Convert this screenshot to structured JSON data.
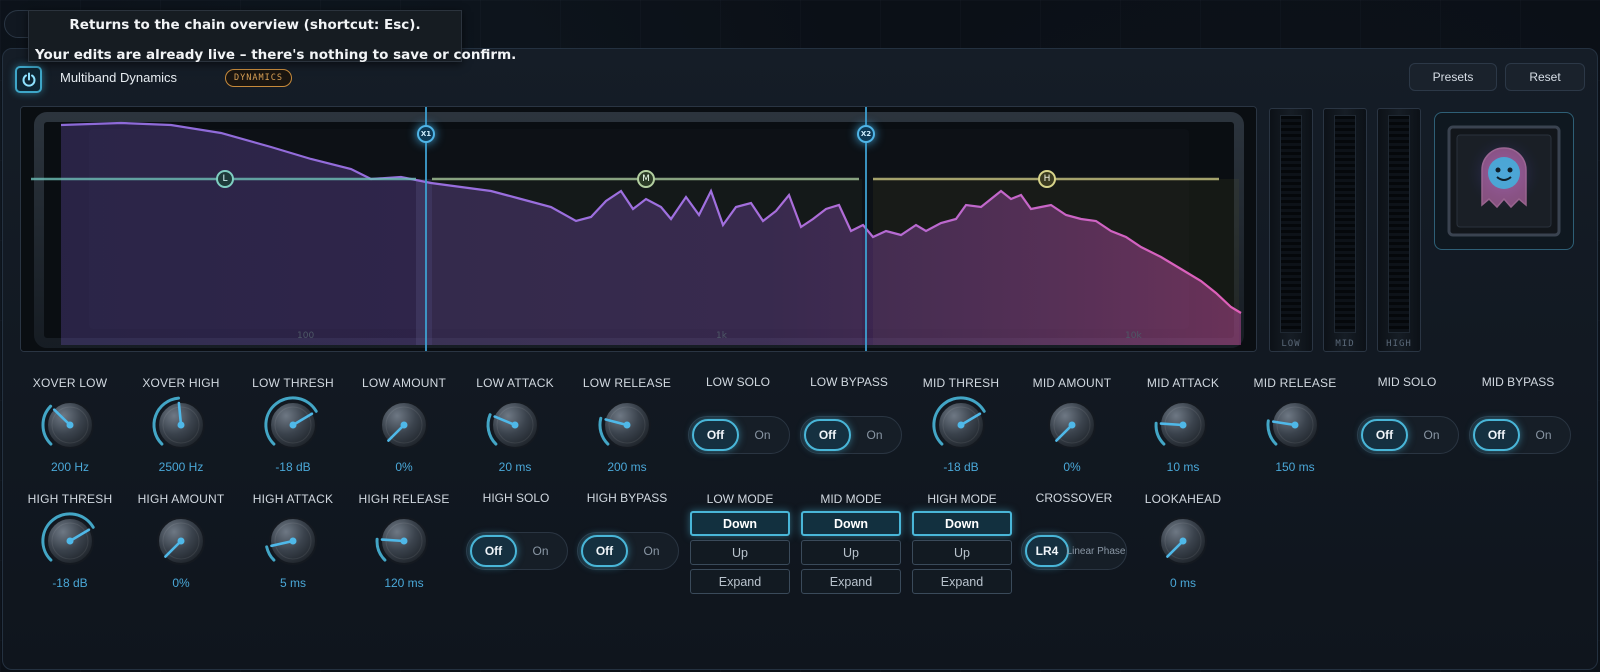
{
  "tooltip": {
    "line1": "Returns to the chain overview (shortcut: Esc).",
    "line2": "Your edits are already live – there's nothing to save or confirm."
  },
  "header": {
    "title": "Multiband Dynamics",
    "badge": "DYNAMICS",
    "presets_label": "Presets",
    "reset_label": "Reset"
  },
  "graph": {
    "crossover_markers": [
      "X1",
      "X2"
    ],
    "band_markers": [
      "L",
      "M",
      "H"
    ],
    "freq_ticks": [
      "100",
      "1k",
      "10k"
    ]
  },
  "meters": [
    "LOW",
    "MID",
    "HIGH"
  ],
  "knobs_row1": [
    {
      "label": "XOVER LOW",
      "value": "200 Hz",
      "level": 0.33
    },
    {
      "label": "XOVER HIGH",
      "value": "2500 Hz",
      "level": 0.48
    },
    {
      "label": "LOW THRESH",
      "value": "-18 dB",
      "level": 0.72
    },
    {
      "label": "LOW AMOUNT",
      "value": "0%",
      "level": 0.0
    },
    {
      "label": "LOW ATTACK",
      "value": "20 ms",
      "level": 0.25
    },
    {
      "label": "LOW RELEASE",
      "value": "200 ms",
      "level": 0.22
    }
  ],
  "knobs_row1b": [
    {
      "label": "MID THRESH",
      "value": "-18 dB",
      "level": 0.72
    },
    {
      "label": "MID AMOUNT",
      "value": "0%",
      "level": 0.0
    },
    {
      "label": "MID ATTACK",
      "value": "10 ms",
      "level": 0.18
    },
    {
      "label": "MID RELEASE",
      "value": "150 ms",
      "level": 0.2
    }
  ],
  "knobs_row2": [
    {
      "label": "HIGH THRESH",
      "value": "-18 dB",
      "level": 0.72
    },
    {
      "label": "HIGH AMOUNT",
      "value": "0%",
      "level": 0.0
    },
    {
      "label": "HIGH ATTACK",
      "value": "5 ms",
      "level": 0.12
    },
    {
      "label": "HIGH RELEASE",
      "value": "120 ms",
      "level": 0.18
    }
  ],
  "lookahead": {
    "label": "LOOKAHEAD",
    "value": "0 ms",
    "level": 0.0
  },
  "toggles": {
    "low_solo": {
      "label": "LOW SOLO",
      "off": "Off",
      "on": "On"
    },
    "low_bypass": {
      "label": "LOW BYPASS",
      "off": "Off",
      "on": "On"
    },
    "mid_solo": {
      "label": "MID SOLO",
      "off": "Off",
      "on": "On"
    },
    "mid_bypass": {
      "label": "MID BYPASS",
      "off": "Off",
      "on": "On"
    },
    "high_solo": {
      "label": "HIGH SOLO",
      "off": "Off",
      "on": "On"
    },
    "high_bypass": {
      "label": "HIGH BYPASS",
      "off": "Off",
      "on": "On"
    },
    "crossover": {
      "label": "CROSSOVER",
      "a": "LR4",
      "b": "Linear Phase"
    }
  },
  "modes": {
    "low": {
      "label": "LOW MODE",
      "options": [
        "Down",
        "Up",
        "Expand"
      ],
      "selected": "Down"
    },
    "mid": {
      "label": "MID MODE",
      "options": [
        "Down",
        "Up",
        "Expand"
      ],
      "selected": "Down"
    },
    "high": {
      "label": "HIGH MODE",
      "options": [
        "Down",
        "Up",
        "Expand"
      ],
      "selected": "Down"
    }
  },
  "colors": {
    "accent": "#49b6d8",
    "value_text": "#4aa8d8",
    "badge": "#d9a055",
    "spectrum_start": "#8c6ad8",
    "spectrum_end": "#e05fb8"
  }
}
